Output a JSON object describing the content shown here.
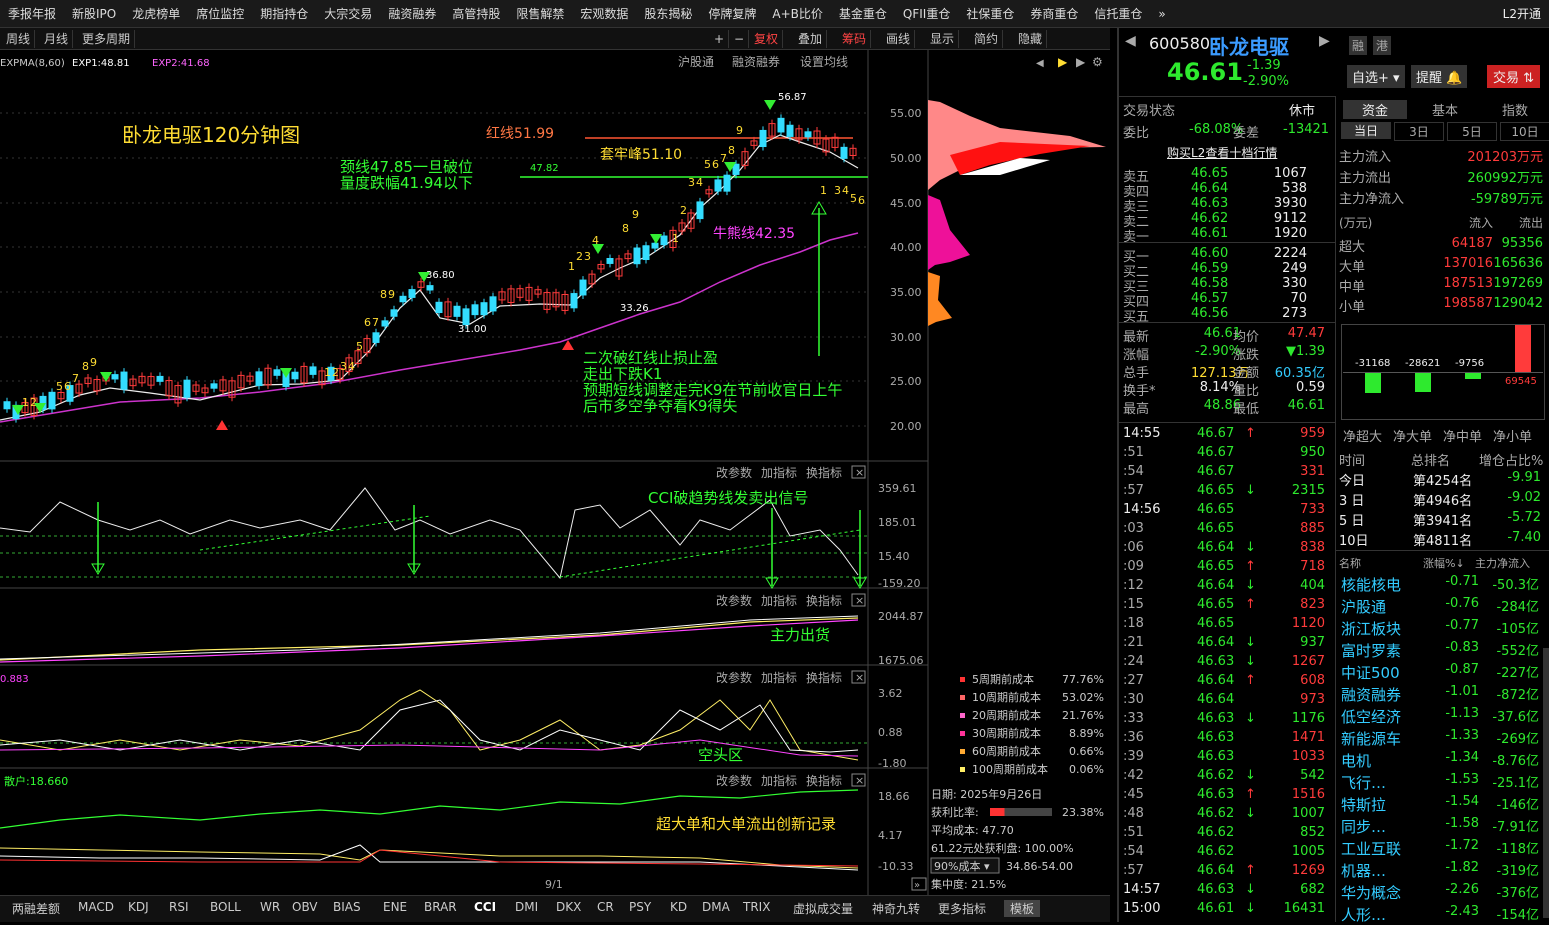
{
  "menu": [
    "季报年报",
    "新股IPO",
    "龙虎榜单",
    "席位监控",
    "期指持仓",
    "大宗交易",
    "融资融券",
    "高管持股",
    "限售解禁",
    "宏观数据",
    "股东揭秘",
    "停牌复牌",
    "A+B比价",
    "基金重仓",
    "QFII重仓",
    "社保重仓",
    "券商重仓",
    "信托重仓",
    "»",
    "L2开通"
  ],
  "toolbar": {
    "left": [
      "周线",
      "月线",
      "更多周期"
    ],
    "right": [
      "+",
      "−",
      "复权",
      "叠加",
      "筹码",
      "画线",
      "显示",
      "简约",
      "隐藏"
    ]
  },
  "indicator_header": {
    "expma": "EXPMA(8,60)",
    "exp1": "EXP1:48.81",
    "exp2": "EXP2:41.68",
    "links": [
      "沪股通",
      "融资融券",
      "设置均线"
    ]
  },
  "annotations": {
    "title": "卧龙电驱120分钟图",
    "neck": "颈线47.85一旦破位",
    "neck2": "量度跌幅41.94以下",
    "red_line": "红线51.99",
    "trap": "套牢峰51.10",
    "bull": "牛熊线42.35",
    "note1": "二次破红线止损止盈",
    "note2": "走出下跌K1",
    "note3": "预期短线调整走完K9在节前收官日上午",
    "note4": "后市多空争夺看K9得失",
    "high": "56.87",
    "p3680": "36.80",
    "p3100": "31.00",
    "p3326": "33.26",
    "p4782": "47.82",
    "cci_note": "CCI破趋势线发卖出信号",
    "main_out": "主力出货",
    "empty": "空头区",
    "big_out": "超大单和大单流出创新记录",
    "retail": "散户:18.660",
    "val0883": "0.883"
  },
  "price_axis": [
    "55.00",
    "50.00",
    "45.00",
    "40.00",
    "35.00",
    "30.00",
    "25.00",
    "20.00"
  ],
  "sub_axes": {
    "cci": [
      "359.61",
      "185.01",
      "15.40",
      "-159.20"
    ],
    "main": [
      "2044.87",
      "1675.06"
    ],
    "osc": [
      "3.62",
      "0.88",
      "-1.80"
    ],
    "retail": [
      "18.66",
      "4.17",
      "-10.33"
    ]
  },
  "panel_ctrl": [
    "改参数",
    "加指标",
    "换指标"
  ],
  "date_marker": "9/1",
  "cost_legend": [
    {
      "label": "5周期前成本",
      "value": "77.76%",
      "color": "#ff3333"
    },
    {
      "label": "10周期前成本",
      "value": "53.02%",
      "color": "#ff6666"
    },
    {
      "label": "20周期前成本",
      "value": "21.76%",
      "color": "#ff66cc"
    },
    {
      "label": "30周期前成本",
      "value": "8.89%",
      "color": "#ff3399"
    },
    {
      "label": "60周期前成本",
      "value": "0.66%",
      "color": "#ffaa33"
    },
    {
      "label": "100周期前成本",
      "value": "0.06%",
      "color": "#ffee66"
    }
  ],
  "chip_info": {
    "date": "日期: 2025年9月26日",
    "profit_label": "获利比率:",
    "profit": "23.38%",
    "avg": "平均成本: 47.70",
    "line": "61.22元处获利盘: 100.00%",
    "cost_sel": "90%成本",
    "cost_range": "34.86-54.00",
    "conc": "集中度: 21.5%"
  },
  "bottom_tabs": [
    "两融差额",
    "MACD",
    "KDJ",
    "RSI",
    "BOLL",
    "WR",
    "OBV",
    "BIAS",
    "ENE",
    "BRAR",
    "CCI",
    "DMI",
    "DKX",
    "CR",
    "PSY",
    "KD",
    "DMA",
    "TRIX",
    "虚拟成交量",
    "神奇九转",
    "更多指标",
    "模板"
  ],
  "stock": {
    "code": "600580",
    "name": "卧龙电驱",
    "price": "46.61",
    "chg": "-1.39",
    "pct": "-2.90%",
    "buttons": [
      "融",
      "港"
    ],
    "actions": [
      "自选+",
      "提醒",
      "交易"
    ]
  },
  "status": {
    "label": "交易状态",
    "value": "休市",
    "wb_label": "委比",
    "wb": "-68.08%",
    "wc_label": "委差",
    "wc": "-13421",
    "l2": "购买L2查看十档行情"
  },
  "asks": [
    [
      "卖五",
      "46.65",
      "1067"
    ],
    [
      "卖四",
      "46.64",
      "538"
    ],
    [
      "卖三",
      "46.63",
      "3930"
    ],
    [
      "卖二",
      "46.62",
      "9112"
    ],
    [
      "卖一",
      "46.61",
      "1920"
    ]
  ],
  "bids": [
    [
      "买一",
      "46.60",
      "2224"
    ],
    [
      "买二",
      "46.59",
      "249"
    ],
    [
      "买三",
      "46.58",
      "330"
    ],
    [
      "买四",
      "46.57",
      "70"
    ],
    [
      "买五",
      "46.56",
      "273"
    ]
  ],
  "stats": [
    [
      "最新",
      "46.61",
      "均价",
      "47.47"
    ],
    [
      "涨幅",
      "-2.90%",
      "涨跌",
      "▼1.39"
    ],
    [
      "总手",
      "127.13万",
      "金额",
      "60.35亿"
    ],
    [
      "换手*",
      "8.14%",
      "量比",
      "0.59"
    ],
    [
      "最高",
      "48.86",
      "最低",
      "46.61"
    ]
  ],
  "ticks": [
    [
      "14:55",
      "46.67",
      "↑",
      "959",
      "r"
    ],
    [
      ":51",
      "46.67",
      "",
      "950",
      "g"
    ],
    [
      ":54",
      "46.67",
      "",
      "331",
      "r"
    ],
    [
      ":57",
      "46.65",
      "↓",
      "2315",
      "g"
    ],
    [
      "14:56",
      "46.65",
      "",
      "733",
      "r"
    ],
    [
      ":03",
      "46.65",
      "",
      "885",
      "r"
    ],
    [
      ":06",
      "46.64",
      "↓",
      "838",
      "r"
    ],
    [
      ":09",
      "46.65",
      "↑",
      "718",
      "r"
    ],
    [
      ":12",
      "46.64",
      "↓",
      "404",
      "g"
    ],
    [
      ":15",
      "46.65",
      "↑",
      "823",
      "r"
    ],
    [
      ":18",
      "46.65",
      "",
      "1120",
      "r"
    ],
    [
      ":21",
      "46.64",
      "↓",
      "937",
      "g"
    ],
    [
      ":24",
      "46.63",
      "↓",
      "1267",
      "r"
    ],
    [
      ":27",
      "46.64",
      "↑",
      "608",
      "r"
    ],
    [
      ":30",
      "46.64",
      "",
      "973",
      "r"
    ],
    [
      ":33",
      "46.63",
      "↓",
      "1176",
      "g"
    ],
    [
      ":36",
      "46.63",
      "",
      "1471",
      "r"
    ],
    [
      ":39",
      "46.63",
      "",
      "1033",
      "r"
    ],
    [
      ":42",
      "46.62",
      "↓",
      "542",
      "g"
    ],
    [
      ":45",
      "46.63",
      "↑",
      "1516",
      "r"
    ],
    [
      ":48",
      "46.62",
      "↓",
      "1007",
      "g"
    ],
    [
      ":51",
      "46.62",
      "",
      "852",
      "g"
    ],
    [
      ":54",
      "46.62",
      "",
      "1005",
      "g"
    ],
    [
      ":57",
      "46.64",
      "↑",
      "1269",
      "r"
    ],
    [
      "14:57",
      "46.63",
      "↓",
      "682",
      "g"
    ],
    [
      "15:00",
      "46.61",
      "↓",
      "16431",
      "g"
    ]
  ],
  "fund_tabs": [
    "资金",
    "基本",
    "指数"
  ],
  "period_tabs": [
    "当日",
    "3日",
    "5日",
    "10日"
  ],
  "flow": [
    [
      "主力流入",
      "201203万元"
    ],
    [
      "主力流出",
      "260992万元"
    ],
    [
      "主力净流入",
      "-59789万元"
    ]
  ],
  "flow_head": [
    "(万元)",
    "流入",
    "流出"
  ],
  "flow_table": [
    [
      "超大",
      "64187",
      "95356"
    ],
    [
      "大单",
      "137016",
      "165636"
    ],
    [
      "中单",
      "187513",
      "197269"
    ],
    [
      "小单",
      "198587",
      "129042"
    ]
  ],
  "net_bars": {
    "labels": [
      "净超大",
      "净大单",
      "净中单",
      "净小单"
    ],
    "values": [
      "-31168",
      "-28621",
      "-9756",
      "69545"
    ],
    "nums": [
      -31168,
      -28621,
      -9756,
      69545
    ]
  },
  "rank_head": [
    "时间",
    "总排名",
    "增仓占比%"
  ],
  "rank": [
    [
      "今日",
      "第4254名",
      "-9.91"
    ],
    [
      "3 日",
      "第4946名",
      "-9.02"
    ],
    [
      "5 日",
      "第3941名",
      "-5.72"
    ],
    [
      "10日",
      "第4811名",
      "-7.40"
    ]
  ],
  "sector_head": [
    "名称",
    "涨幅%↓",
    "主力净流入"
  ],
  "sectors": [
    [
      "核能核电",
      "-0.71",
      "-50.3亿"
    ],
    [
      "沪股通",
      "-0.76",
      "-284亿"
    ],
    [
      "浙江板块",
      "-0.77",
      "-105亿"
    ],
    [
      "富时罗素",
      "-0.83",
      "-552亿"
    ],
    [
      "中证500",
      "-0.87",
      "-227亿"
    ],
    [
      "融资融券",
      "-1.01",
      "-872亿"
    ],
    [
      "低空经济",
      "-1.13",
      "-37.6亿"
    ],
    [
      "新能源车",
      "-1.33",
      "-269亿"
    ],
    [
      "电机",
      "-1.34",
      "-8.76亿"
    ],
    [
      "飞行…",
      "-1.53",
      "-25.1亿"
    ],
    [
      "特斯拉",
      "-1.54",
      "-146亿"
    ],
    [
      "同步…",
      "-1.58",
      "-7.91亿"
    ],
    [
      "工业互联",
      "-1.72",
      "-118亿"
    ],
    [
      "机器…",
      "-1.82",
      "-319亿"
    ],
    [
      "华为概念",
      "-2.26",
      "-376亿"
    ],
    [
      "人形…",
      "-2.43",
      "-154亿"
    ]
  ]
}
